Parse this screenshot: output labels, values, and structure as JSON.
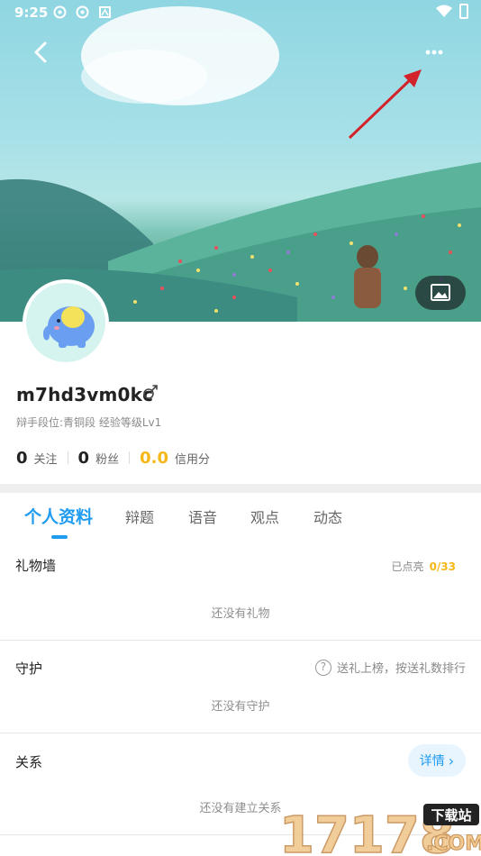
{
  "status_bar": {
    "time": "9:25"
  },
  "header": {
    "back_icon": "chevron-left-icon",
    "more_icon": "more-horizontal-icon",
    "cover_icon": "image-icon"
  },
  "profile": {
    "username": "m7hd3vm0kc",
    "gender_icon": "male-icon",
    "rank_line": "辩手段位:青铜段 经验等级Lv1",
    "stats": [
      {
        "value": "0",
        "label": "关注"
      },
      {
        "value": "0",
        "label": "粉丝"
      },
      {
        "value": "0.0",
        "label": "信用分"
      }
    ]
  },
  "tabs": [
    "个人资料",
    "辩题",
    "语音",
    "观点",
    "动态"
  ],
  "sections": {
    "gifts": {
      "title": "礼物墙",
      "lit_label": "已点亮",
      "lit_value": "0/33",
      "empty": "还没有礼物"
    },
    "guard": {
      "title": "守护",
      "hint": "送礼上榜，按送礼数排行",
      "empty": "还没有守护"
    },
    "relation": {
      "title": "关系",
      "detail_label": "详情",
      "empty": "还没有建立关系"
    }
  },
  "watermark": {
    "text": "17178",
    "badge": "下载站",
    "domain": ".COM"
  },
  "colors": {
    "accent": "#1f9bf0",
    "gold": "#f5b818"
  }
}
